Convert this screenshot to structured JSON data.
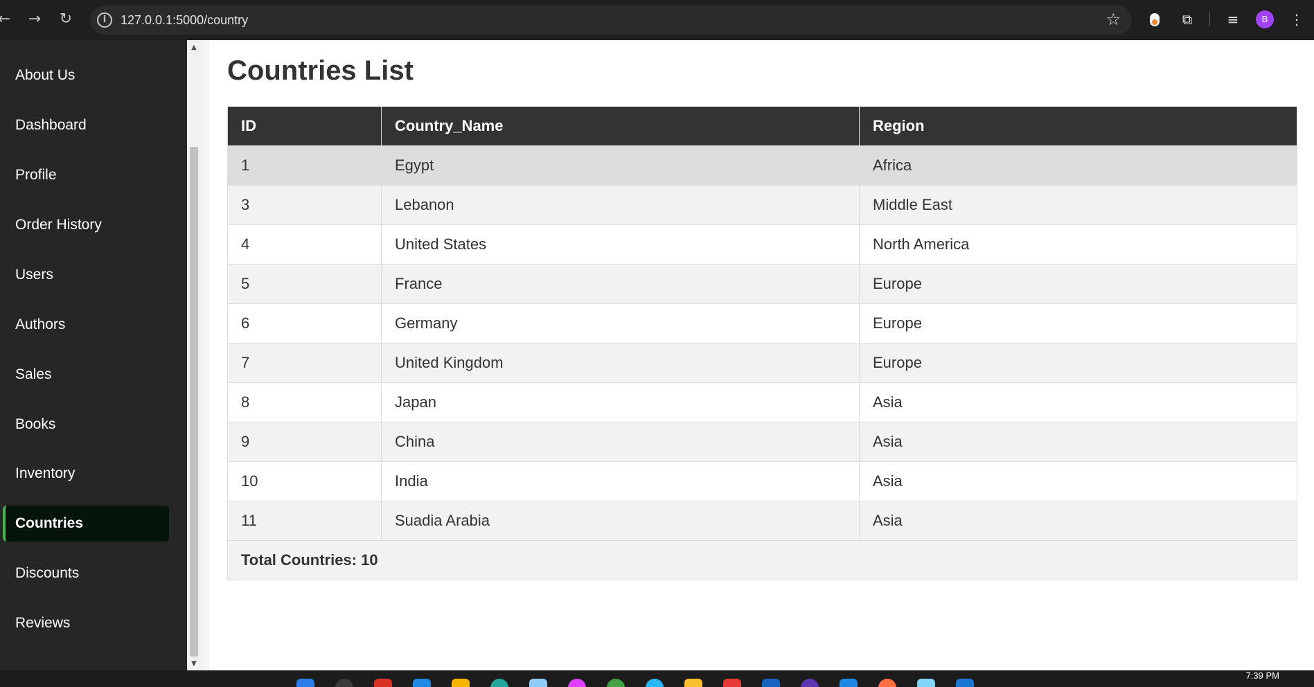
{
  "browser": {
    "url": "127.0.0.1:5000/country",
    "back_icon": "←",
    "forward_icon": "→",
    "reload_icon": "↻",
    "info_icon": "i",
    "star_icon": "☆",
    "extensions_icon": "⧉",
    "reading_list_icon": "≡",
    "menu_icon": "⋮",
    "profile_initial": "B"
  },
  "sidebar": {
    "items": [
      {
        "label": "About Us"
      },
      {
        "label": "Dashboard"
      },
      {
        "label": "Profile"
      },
      {
        "label": "Order History"
      },
      {
        "label": "Users"
      },
      {
        "label": "Authors"
      },
      {
        "label": "Sales"
      },
      {
        "label": "Books"
      },
      {
        "label": "Inventory"
      },
      {
        "label": "Countries",
        "active": true
      },
      {
        "label": "Discounts"
      },
      {
        "label": "Reviews"
      }
    ]
  },
  "main": {
    "title": "Countries List",
    "table": {
      "headers": [
        "ID",
        "Country_Name",
        "Region"
      ],
      "rows": [
        [
          "1",
          "Egypt",
          "Africa"
        ],
        [
          "3",
          "Lebanon",
          "Middle East"
        ],
        [
          "4",
          "United States",
          "North America"
        ],
        [
          "5",
          "France",
          "Europe"
        ],
        [
          "6",
          "Germany",
          "Europe"
        ],
        [
          "7",
          "United Kingdom",
          "Europe"
        ],
        [
          "8",
          "Japan",
          "Asia"
        ],
        [
          "9",
          "China",
          "Asia"
        ],
        [
          "10",
          "India",
          "Asia"
        ],
        [
          "11",
          "Suadia Arabia",
          "Asia"
        ]
      ],
      "total_label": "Total Countries: 10"
    }
  },
  "taskbar": {
    "time": "7:39 PM"
  },
  "colors": {
    "accent": "#4caf50",
    "sidebar_bg": "#262626",
    "header_bg": "#333333"
  }
}
